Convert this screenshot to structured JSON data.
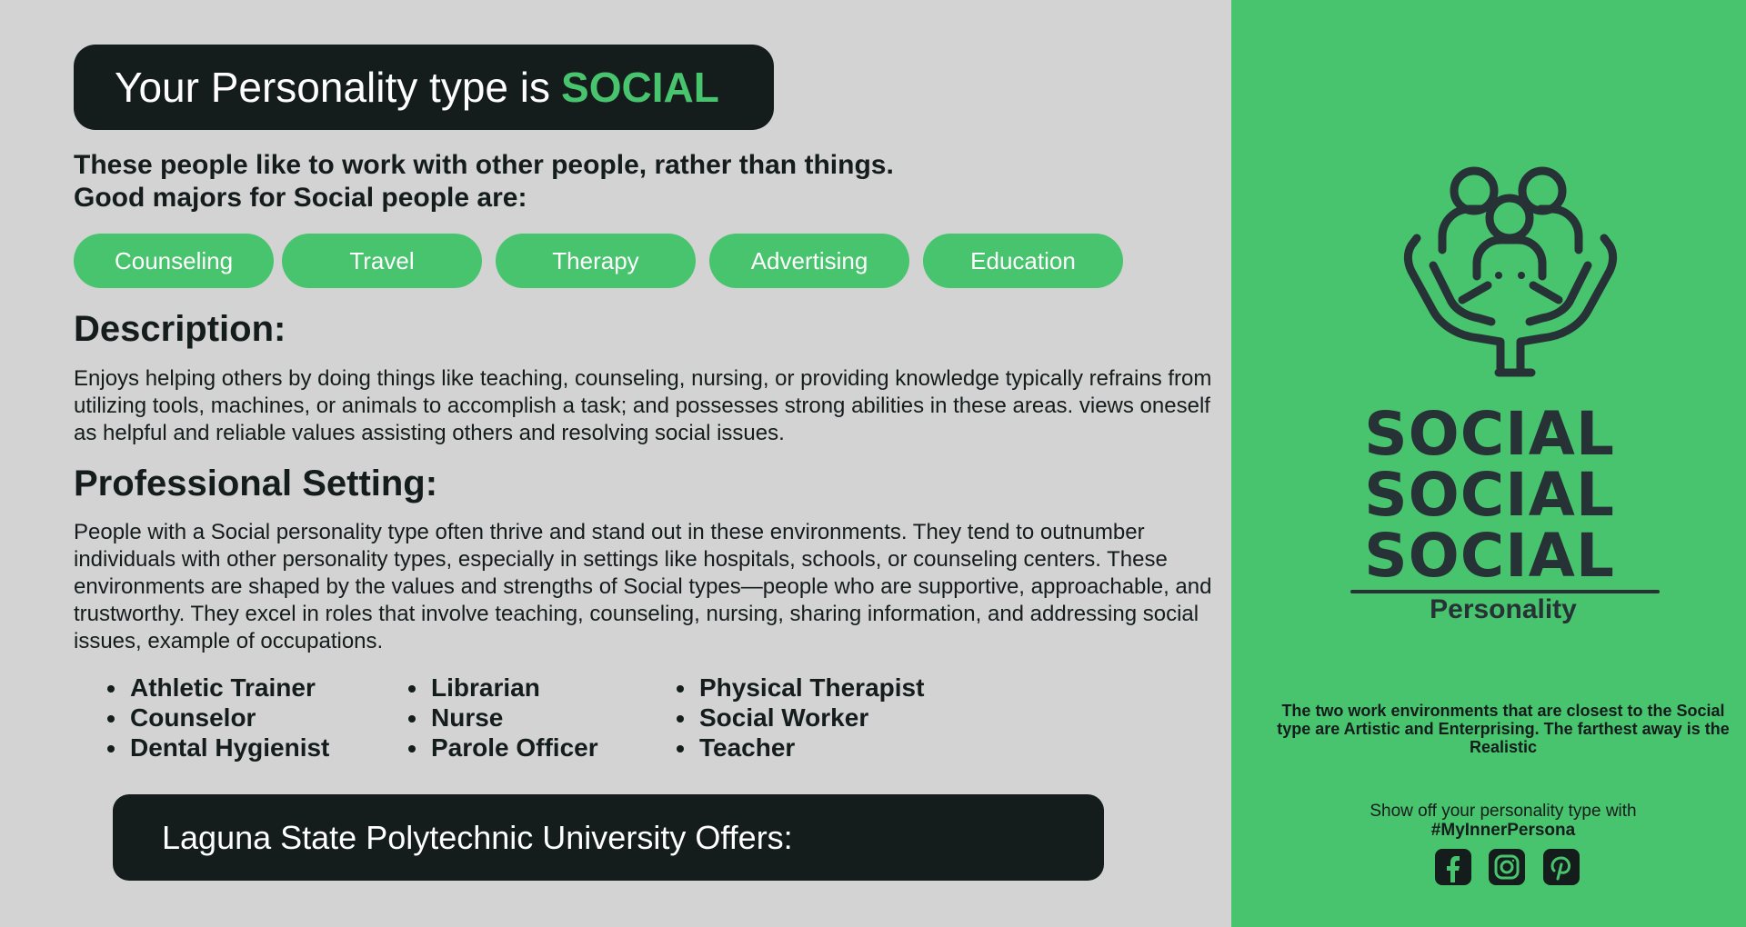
{
  "header": {
    "title_prefix": "Your Personality type is",
    "title_highlight": "SOCIAL"
  },
  "intro": {
    "line1": "These people like to work with other people, rather than things.",
    "line2": "Good majors for Social people are:"
  },
  "majors": [
    "Counseling",
    "Travel",
    "Therapy",
    "Advertising",
    "Education"
  ],
  "description": {
    "heading": "Description:",
    "text": "Enjoys helping others by doing things like teaching, counseling, nursing, or providing knowledge typically refrains from utilizing tools, machines, or animals to accomplish a task; and possesses strong abilities in these areas. views oneself as helpful and reliable values assisting others and resolving social issues."
  },
  "professional": {
    "heading": "Professional Setting:",
    "text": "People with a Social personality type often thrive and stand out in these environments. They tend to outnumber individuals with other personality types, especially in settings like hospitals, schools, or counseling centers. These environments are shaped by the values and strengths of Social types—people who are supportive, approachable, and trustworthy. They excel in roles that involve teaching, counseling, nursing, sharing information, and addressing social issues, example of occupations."
  },
  "occupations": [
    [
      "Athletic Trainer",
      "Counselor",
      "Dental Hygienist"
    ],
    [
      "Librarian",
      "Nurse",
      "Parole Officer"
    ],
    [
      "Physical Therapist",
      "Social Worker",
      "Teacher"
    ]
  ],
  "offer": {
    "label": "Laguna State Polytechnic University Offers:"
  },
  "sidebar": {
    "emblem_icon": "people-in-hands-icon",
    "big_word": "SOCIAL",
    "subtitle": "Personality",
    "closest_text": "The two work environments that are closest to the Social type are Artistic and Enterprising. The farthest away is the Realistic",
    "share_text": "Show off your personality type with",
    "hashtag": "#MyInnerPersona",
    "social_icons": [
      "facebook-icon",
      "instagram-icon",
      "pinterest-icon"
    ]
  },
  "colors": {
    "accent": "#48c46e",
    "dark": "#141c1c",
    "background": "#d3d3d3",
    "sidebar_text": "#263235"
  }
}
